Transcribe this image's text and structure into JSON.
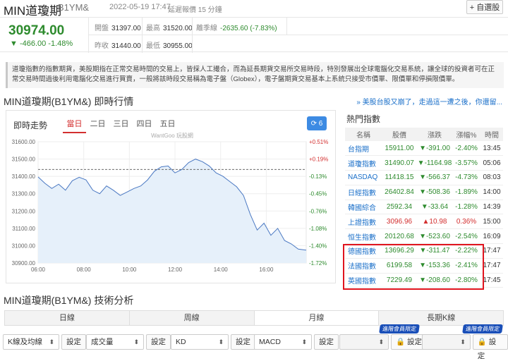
{
  "header": {
    "title": "MIN道瓊期",
    "code": "B1YM&",
    "time": "2022-05-19 17:47",
    "delay": "延遲報價 15 分鐘",
    "watch_button": "+ 自選股"
  },
  "quote": {
    "price": "30974.00",
    "change": "▼ -466.00  -1.48%",
    "open_label": "開盤",
    "open": "31397.00",
    "high_label": "最高",
    "high": "31520.00",
    "spread_label": "離季線",
    "spread": "-2635.60 (-7.83%)",
    "prev_label": "昨收",
    "prev": "31440.00",
    "low_label": "最低",
    "low": "30955.00"
  },
  "description": "道瓊指數的指數期貨，美股期指在正常交易時間的交易上，皆採人工撮合，而為延長期貨交易所交易時段，特別發展出全球電腦化交易系統，讓全球的投資者可在正常交易時間過後利用電腦化交易進行買賣，一般將該時段交易稱為電子盤（Globex），電子盤期貨交易基本上系統只接受市價單、限價單和停損限價單。",
  "realtime": {
    "section_title": "MIN道瓊期(B1YM&) 即時行情",
    "promo_link": "» 美股台股又崩了，走過這一遭之後，你還留...",
    "chart_label": "即時走勢",
    "tabs": [
      "當日",
      "二日",
      "三日",
      "四日",
      "五日"
    ],
    "refresh": "⟳ 6",
    "watermark": "WantGoo 玩股網"
  },
  "chart_data": {
    "type": "line",
    "x_ticks": [
      "06:00",
      "08:00",
      "10:00",
      "12:00",
      "14:00",
      "16:00"
    ],
    "y_ticks": [
      "31600.00",
      "31500.00",
      "31400.00",
      "31300.00",
      "31200.00",
      "31100.00",
      "31000.00",
      "30900.00"
    ],
    "pct_ticks": [
      "+0.51%",
      "+0.19%",
      "-0.13%",
      "-0.45%",
      "-0.76%",
      "-1.08%",
      "-1.40%",
      "-1.72%"
    ],
    "ylim": [
      30900,
      31600
    ],
    "xlim": [
      6,
      17.75
    ],
    "reference": 31440,
    "x": [
      6.0,
      6.3,
      6.6,
      6.9,
      7.2,
      7.5,
      7.8,
      8.1,
      8.4,
      8.7,
      9.0,
      9.3,
      9.6,
      9.9,
      10.2,
      10.5,
      10.8,
      11.1,
      11.4,
      11.7,
      12.0,
      12.3,
      12.6,
      12.9,
      13.2,
      13.5,
      13.8,
      14.1,
      14.4,
      14.7,
      15.0,
      15.3,
      15.6,
      15.9,
      16.2,
      16.5,
      16.8,
      17.1,
      17.4,
      17.75
    ],
    "y": [
      31397,
      31360,
      31330,
      31355,
      31320,
      31375,
      31395,
      31380,
      31320,
      31300,
      31345,
      31320,
      31290,
      31310,
      31330,
      31345,
      31380,
      31430,
      31455,
      31460,
      31420,
      31440,
      31480,
      31500,
      31485,
      31460,
      31420,
      31400,
      31370,
      31340,
      31290,
      31180,
      31090,
      31130,
      31060,
      31100,
      31030,
      31010,
      30980,
      30974
    ]
  },
  "hot": {
    "title": "熱門指數",
    "headers": [
      "名稱",
      "股價",
      "漲跌",
      "漲幅%",
      "時間"
    ],
    "rows": [
      {
        "name": "台指期",
        "price": "15911.00",
        "chg": "▼-391.00",
        "pct": "-2.40%",
        "time": "13:45",
        "dir": "down"
      },
      {
        "name": "道瓊指數",
        "price": "31490.07",
        "chg": "▼-1164.98",
        "pct": "-3.57%",
        "time": "05:06",
        "dir": "down"
      },
      {
        "name": "NASDAQ",
        "price": "11418.15",
        "chg": "▼-566.37",
        "pct": "-4.73%",
        "time": "08:03",
        "dir": "down"
      },
      {
        "name": "日經指數",
        "price": "26402.84",
        "chg": "▼-508.36",
        "pct": "-1.89%",
        "time": "14:00",
        "dir": "down"
      },
      {
        "name": "韓國綜合",
        "price": "2592.34",
        "chg": "▼-33.64",
        "pct": "-1.28%",
        "time": "14:39",
        "dir": "down"
      },
      {
        "name": "上證指數",
        "price": "3096.96",
        "chg": "▲10.98",
        "pct": "0.36%",
        "time": "15:00",
        "dir": "up"
      },
      {
        "name": "恒生指數",
        "price": "20120.68",
        "chg": "▼-523.60",
        "pct": "-2.54%",
        "time": "16:09",
        "dir": "down"
      },
      {
        "name": "德國指數",
        "price": "13696.29",
        "chg": "▼-311.47",
        "pct": "-2.22%",
        "time": "17:47",
        "dir": "down"
      },
      {
        "name": "法國指數",
        "price": "6199.58",
        "chg": "▼-153.36",
        "pct": "-2.41%",
        "time": "17:47",
        "dir": "down"
      },
      {
        "name": "英國指數",
        "price": "7229.49",
        "chg": "▼-208.60",
        "pct": "-2.80%",
        "time": "17:45",
        "dir": "down"
      }
    ]
  },
  "tech": {
    "section_title": "MIN道瓊期(B1YM&) 技術分析",
    "periods": [
      "日線",
      "周線",
      "月線",
      "長期K線"
    ],
    "selects": [
      "K線及均線",
      "成交量",
      "KD",
      "MACD"
    ],
    "set_label": "設定",
    "locked_set_label": "🔒 設定",
    "vip_badge": "進階會員限定"
  },
  "colors": {
    "up": "#d32f2f",
    "down": "#2e8b2e",
    "link": "#1a6fc9",
    "highlight_box": "#e0141e"
  }
}
